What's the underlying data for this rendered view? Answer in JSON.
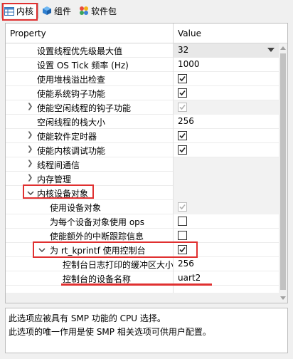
{
  "tabs": [
    {
      "label": "内核",
      "icon": "kernel-table-icon",
      "active": true
    },
    {
      "label": "组件",
      "icon": "component-cube-icon",
      "active": false
    },
    {
      "label": "软件包",
      "icon": "package-blocks-icon",
      "active": false
    }
  ],
  "table": {
    "header_property": "Property",
    "header_value": "Value",
    "rows": [
      {
        "label": "设置线程优先级最大值",
        "value": "32",
        "kind": "dropdown"
      },
      {
        "label": "设置 OS Tick 频率 (Hz)",
        "value": "1000",
        "kind": "text"
      },
      {
        "label": "使用堆栈溢出检查",
        "checked": true,
        "kind": "check"
      },
      {
        "label": "使能系统钩子功能",
        "checked": true,
        "kind": "check"
      },
      {
        "label": "使能空闲线程的钩子功能",
        "checked": true,
        "disabled": true,
        "kind": "check",
        "expandable": true
      },
      {
        "label": "空闲线程的栈大小",
        "value": "256",
        "kind": "text"
      },
      {
        "label": "使能软件定时器",
        "checked": true,
        "kind": "check",
        "expandable": true
      },
      {
        "label": "使能内核调试功能",
        "checked": true,
        "kind": "check",
        "expandable": true
      },
      {
        "label": "线程间通信",
        "kind": "group",
        "expandable": true
      },
      {
        "label": "内存管理",
        "kind": "group",
        "expandable": true
      },
      {
        "label": "内核设备对象",
        "kind": "group",
        "expanded": true
      },
      {
        "label": "使用设备对象",
        "checked": true,
        "disabled": true,
        "kind": "check"
      },
      {
        "label": "为每个设备对象使用 ops",
        "checked": false,
        "kind": "check"
      },
      {
        "label": "使能额外的中断跟踪信息",
        "checked": false,
        "kind": "check"
      },
      {
        "label": "为 rt_kprintf 使用控制台",
        "checked": true,
        "kind": "check",
        "expanded": true
      },
      {
        "label": "控制台日志打印的缓冲区大小",
        "value": "256",
        "kind": "text"
      },
      {
        "label": "控制台的设备名称",
        "value": "uart2",
        "kind": "text"
      }
    ]
  },
  "description": {
    "line1": "此选项应被具有 SMP 功能的 CPU 选择。",
    "line2": "此选项的唯一作用是使 SMP 相关选项可供用户配置。"
  },
  "colors": {
    "annotation": "#e03030",
    "grid": "#ececec"
  }
}
